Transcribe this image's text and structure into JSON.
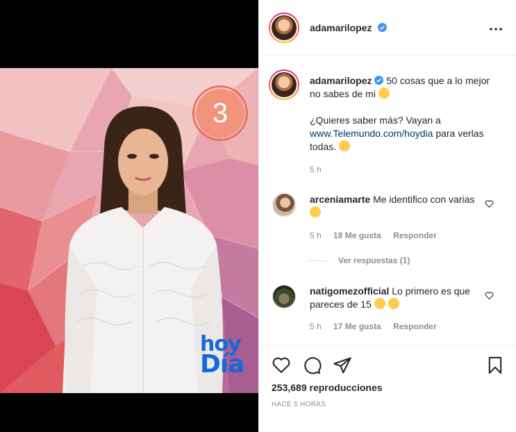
{
  "video": {
    "counter": "3",
    "logo_line1": "hoy",
    "logo_line2": "Día"
  },
  "header": {
    "username": "adamarilopez",
    "verified_icon": "verified-badge-icon",
    "more_icon": "more-options-icon"
  },
  "caption": {
    "username": "adamarilopez",
    "text_part1": "50 cosas que a lo mejor no sabes de mi",
    "text_part2": "¿Quieres saber más? Vayan a",
    "link": "www.Telemundo.com/hoydia",
    "text_part3": "para verlas todas.",
    "time": "5 h"
  },
  "comments": [
    {
      "username": "arceniamarte",
      "text": "Me identifico con varias",
      "time": "5 h",
      "likes": "18 Me gusta",
      "reply": "Responder"
    },
    {
      "username": "natigomezofficial",
      "text": "Lo primero es que pareces de 15",
      "time": "5 h",
      "likes": "17 Me gusta",
      "reply": "Responder"
    }
  ],
  "view_replies": "Ver respuestas (1)",
  "actions": {
    "views": "253,689 reproducciones",
    "posted": "HACE 5 HORAS"
  },
  "colors": {
    "verified": "#3897f0",
    "link": "#00376b",
    "muted": "#8e8e8e",
    "hoydia_blue": "#1668d6"
  }
}
